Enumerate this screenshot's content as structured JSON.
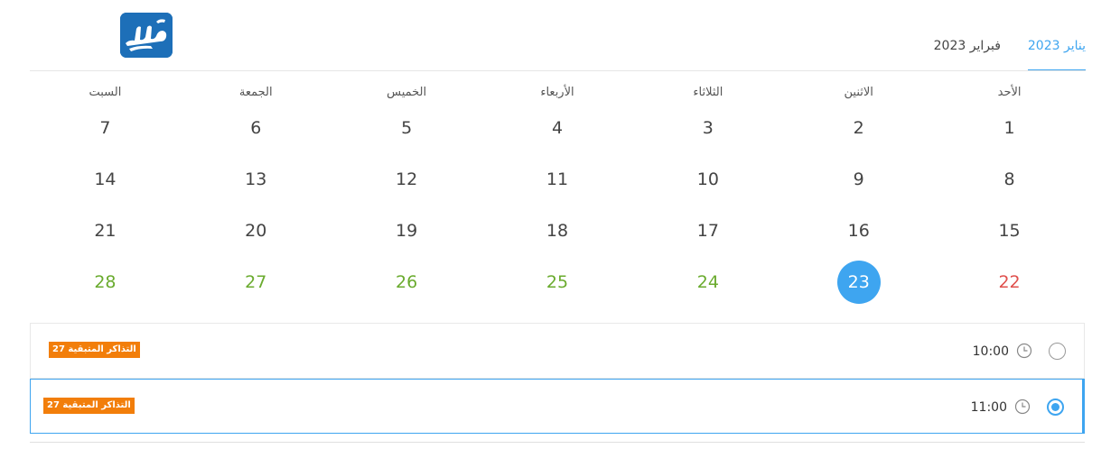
{
  "logo": {
    "text": "المرجع",
    "color": "#1d6fb8"
  },
  "tabs": [
    {
      "label": "يناير 2023",
      "active": true
    },
    {
      "label": "فبراير 2023",
      "active": false
    }
  ],
  "weekdays": [
    "الأحد",
    "الاثنين",
    "الثلاثاء",
    "الأربعاء",
    "الخميس",
    "الجمعة",
    "السبت"
  ],
  "weeks": [
    [
      {
        "d": "1",
        "s": ""
      },
      {
        "d": "2",
        "s": ""
      },
      {
        "d": "3",
        "s": ""
      },
      {
        "d": "4",
        "s": ""
      },
      {
        "d": "5",
        "s": ""
      },
      {
        "d": "6",
        "s": ""
      },
      {
        "d": "7",
        "s": ""
      }
    ],
    [
      {
        "d": "8",
        "s": ""
      },
      {
        "d": "9",
        "s": ""
      },
      {
        "d": "10",
        "s": ""
      },
      {
        "d": "11",
        "s": ""
      },
      {
        "d": "12",
        "s": ""
      },
      {
        "d": "13",
        "s": ""
      },
      {
        "d": "14",
        "s": ""
      }
    ],
    [
      {
        "d": "15",
        "s": ""
      },
      {
        "d": "16",
        "s": ""
      },
      {
        "d": "17",
        "s": ""
      },
      {
        "d": "18",
        "s": ""
      },
      {
        "d": "19",
        "s": ""
      },
      {
        "d": "20",
        "s": ""
      },
      {
        "d": "21",
        "s": ""
      }
    ],
    [
      {
        "d": "22",
        "s": "past-red"
      },
      {
        "d": "23",
        "s": "selected"
      },
      {
        "d": "24",
        "s": "avail"
      },
      {
        "d": "25",
        "s": "avail"
      },
      {
        "d": "26",
        "s": "avail"
      },
      {
        "d": "27",
        "s": "avail"
      },
      {
        "d": "28",
        "s": "avail"
      }
    ]
  ],
  "colors": {
    "accent": "#3ea5f0",
    "available": "#6aab2e",
    "unavailable": "#e0504d",
    "badge": "#f27e0a"
  },
  "slots": [
    {
      "time": "10:00",
      "badge": "التذاكر المتبقية 27",
      "selected": false,
      "icon": "clock-icon"
    },
    {
      "time": "11:00",
      "badge": "التذاكر المتبقية 27",
      "selected": true,
      "icon": "clock-icon"
    }
  ]
}
